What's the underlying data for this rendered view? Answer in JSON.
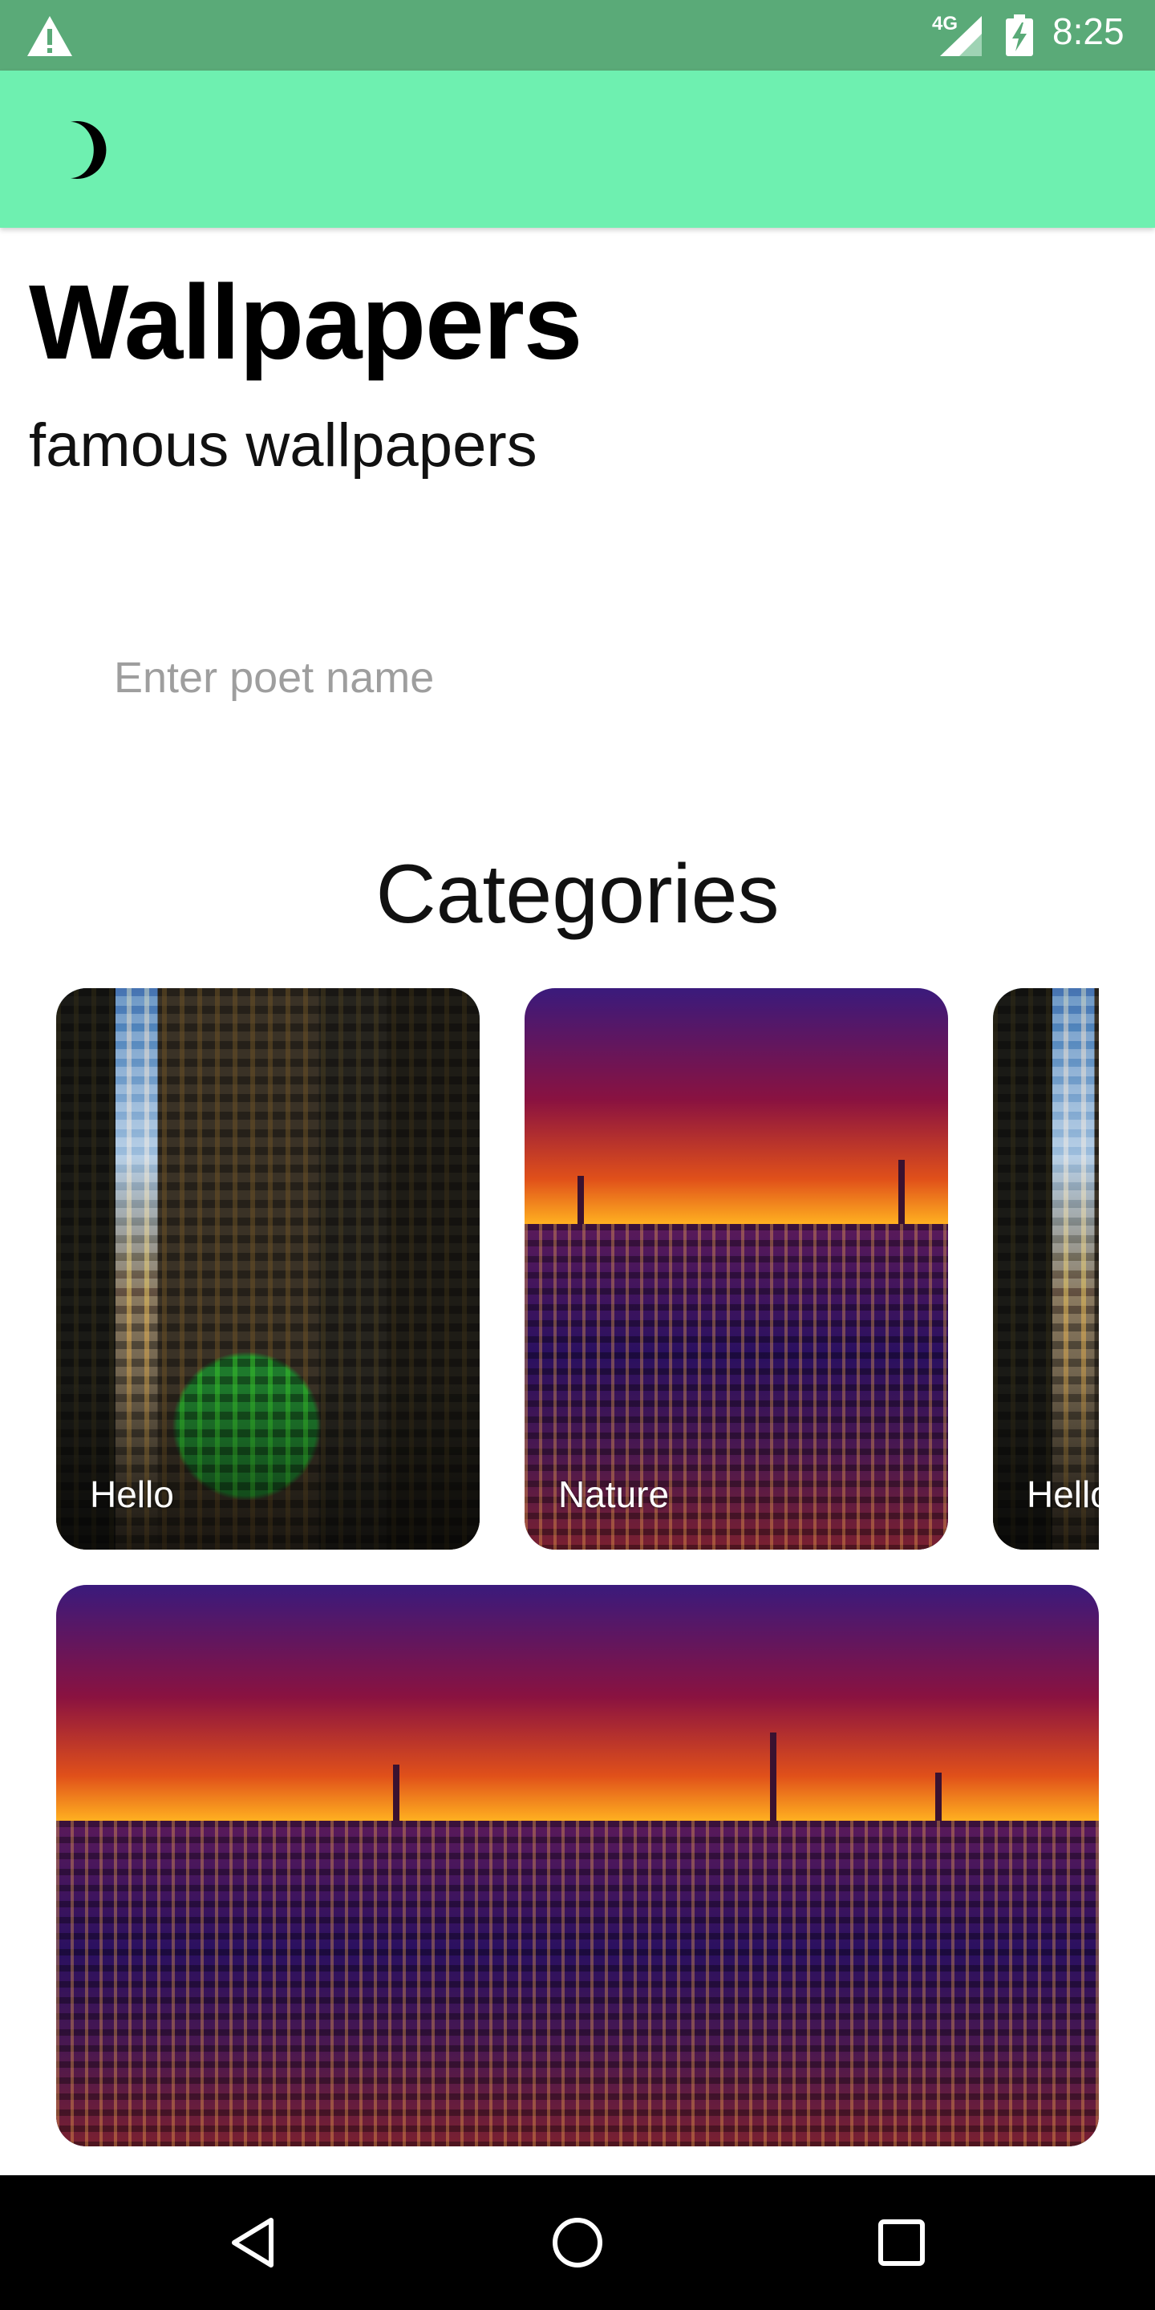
{
  "status_bar": {
    "network": "4G",
    "time": "8:25",
    "icons": [
      "warning-icon",
      "signal-icon",
      "battery-charging-icon"
    ]
  },
  "app_bar": {
    "theme_toggle_icon": "moon-icon",
    "color": "#6ef0b0"
  },
  "header": {
    "title": "Wallpapers",
    "subtitle": "famous wallpapers"
  },
  "search": {
    "placeholder": "Enter poet name",
    "value": ""
  },
  "categories": {
    "title": "Categories",
    "items": [
      {
        "label": "Hello"
      },
      {
        "label": "Nature"
      },
      {
        "label": "Hello"
      }
    ]
  },
  "nav": {
    "icons": [
      "back-icon",
      "home-icon",
      "recents-icon"
    ]
  }
}
